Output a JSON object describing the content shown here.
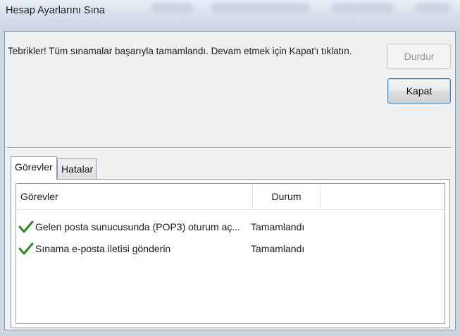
{
  "window": {
    "title": "Hesap Ayarlarını Sına"
  },
  "message": "Tebrikler! Tüm sınamalar başarıyla tamamlandı. Devam etmek için Kapat'ı tıklatın.",
  "buttons": {
    "stop_label": "Durdur",
    "close_label": "Kapat"
  },
  "tabs": [
    {
      "label": "Görevler",
      "active": true
    },
    {
      "label": "Hatalar",
      "active": false
    }
  ],
  "table": {
    "columns": [
      "Görevler",
      "Durum"
    ],
    "rows": [
      {
        "icon": "check-icon",
        "task": "Gelen posta sunucusunda (POP3) oturum aç...",
        "status": "Tamamlandı"
      },
      {
        "icon": "check-icon",
        "task": "Sınama e-posta iletisi gönderin",
        "status": "Tamamlandı"
      }
    ]
  },
  "colors": {
    "check": "#2f8a24",
    "default_button_border": "#3c7fb1"
  }
}
